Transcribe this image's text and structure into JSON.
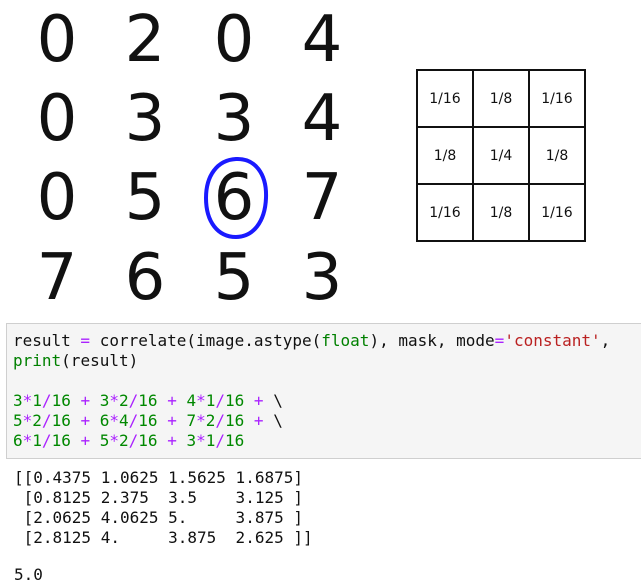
{
  "image_grid": {
    "rows": [
      [
        "0",
        "2",
        "0",
        "4"
      ],
      [
        "0",
        "3",
        "3",
        "4"
      ],
      [
        "0",
        "5",
        "6",
        "7"
      ],
      [
        "7",
        "6",
        "5",
        "3"
      ]
    ],
    "highlighted": {
      "row": 2,
      "col": 2
    }
  },
  "kernel": {
    "rows": [
      [
        "1/16",
        "1/8",
        "1/16"
      ],
      [
        "1/8",
        "1/4",
        "1/8"
      ],
      [
        "1/16",
        "1/8",
        "1/16"
      ]
    ]
  },
  "code": {
    "line1_var": "result",
    "line1_eq": " = ",
    "line1_fn": "correlate(image.astype(",
    "line1_float": "float",
    "line1_mid": "), mask, mode",
    "line1_eq2": "=",
    "line1_str": "'constant'",
    "line1_end": ",",
    "line2_print": "print",
    "line2_rest": "(result)",
    "expr_lines": [
      [
        "3",
        "*",
        "1",
        "/",
        "16",
        " + ",
        "3",
        "*",
        "2",
        "/",
        "16",
        " + ",
        "4",
        "*",
        "1",
        "/",
        "16",
        " + ",
        "\\"
      ],
      [
        "5",
        "*",
        "2",
        "/",
        "16",
        " + ",
        "6",
        "*",
        "4",
        "/",
        "16",
        " + ",
        "7",
        "*",
        "2",
        "/",
        "16",
        " + ",
        "\\"
      ],
      [
        "6",
        "*",
        "1",
        "/",
        "16",
        " + ",
        "5",
        "*",
        "2",
        "/",
        "16",
        " + ",
        "3",
        "*",
        "1",
        "/",
        "16"
      ]
    ]
  },
  "output": {
    "array_lines": [
      "[[0.4375 1.0625 1.5625 1.6875]",
      " [0.8125 2.375  3.5    3.125 ]",
      " [2.0625 4.0625 5.     3.875 ]",
      " [2.8125 4.     3.875  2.625 ]]"
    ],
    "scalar": "5.0"
  },
  "colors": {
    "highlight_ring": "#1a1aff",
    "operator": "#aa22ff",
    "number": "#008800",
    "string": "#ba2121"
  }
}
